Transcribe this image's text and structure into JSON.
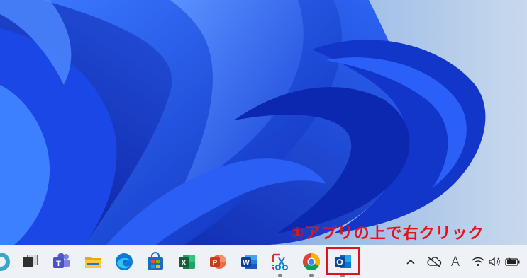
{
  "annotation": {
    "text": "①アプリの上で右クリック",
    "color": "#e3131b"
  },
  "wallpaper": {
    "name": "windows-11-bloom",
    "colors": [
      "#0b2fc8",
      "#1f5cff",
      "#c6d8ee"
    ]
  },
  "taskbar": {
    "pinned": [
      {
        "name": "start-partial-icon"
      },
      {
        "name": "task-view-icon"
      },
      {
        "name": "teams-icon"
      },
      {
        "name": "file-explorer-icon"
      },
      {
        "name": "edge-icon"
      },
      {
        "name": "microsoft-store-icon"
      },
      {
        "name": "excel-icon"
      },
      {
        "name": "powerpoint-icon"
      },
      {
        "name": "word-icon"
      },
      {
        "name": "snipping-tool-icon"
      },
      {
        "name": "chrome-icon"
      },
      {
        "name": "outlook-icon"
      }
    ],
    "tray": [
      {
        "name": "show-hidden-icons-chevron"
      },
      {
        "name": "onedrive-offline-icon"
      },
      {
        "name": "ime-mode-icon",
        "label": "A"
      },
      {
        "name": "wifi-icon"
      },
      {
        "name": "volume-icon"
      },
      {
        "name": "battery-icon"
      }
    ]
  }
}
